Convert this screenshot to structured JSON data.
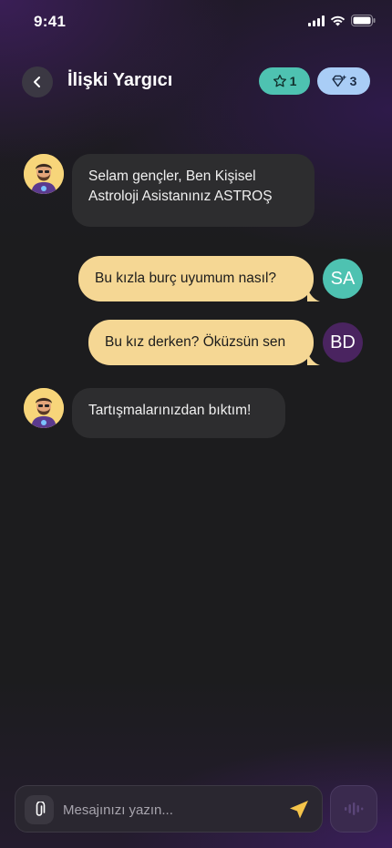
{
  "status_bar": {
    "time": "9:41"
  },
  "header": {
    "title": "İlişki Yargıcı",
    "stars_count": "1",
    "gems_count": "3"
  },
  "messages": [
    {
      "sender": "bot",
      "text_line1": "Selam gençler, Ben Kişisel",
      "text_line2": "Astroloji Asistanınız ASTROŞ"
    },
    {
      "sender": "user",
      "initials": "SA",
      "avatar_color": "#4ec2b1",
      "text": "Bu kızla burç uyumum nasıl?"
    },
    {
      "sender": "user",
      "initials": "BD",
      "avatar_color": "#4a2460",
      "text": "Bu kız derken? Öküzsün sen"
    },
    {
      "sender": "bot",
      "text": "Tartışmalarınızdan bıktım!"
    }
  ],
  "composer": {
    "placeholder": "Mesajınızı yazın..."
  },
  "colors": {
    "user_bubble": "#f5d794",
    "bot_bubble": "#2d2d2f",
    "accent_send": "#f5c44a"
  }
}
